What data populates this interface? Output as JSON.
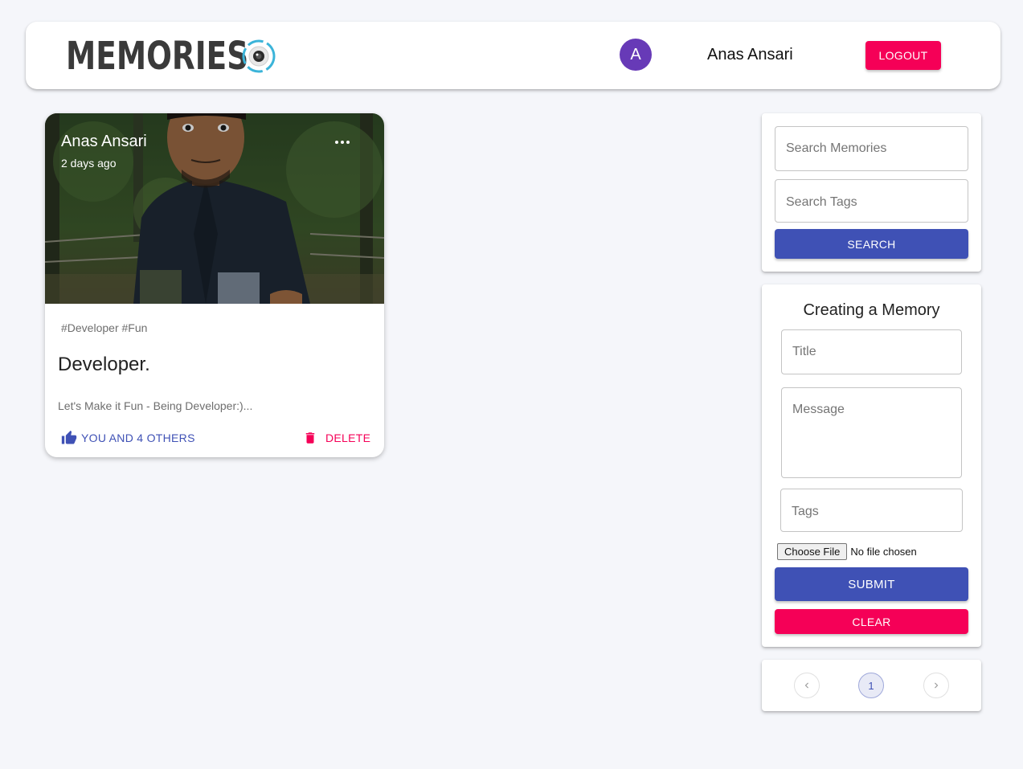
{
  "colors": {
    "primary": "#3f51b5",
    "secondary": "#f50057",
    "avatar": "#673ab7"
  },
  "header": {
    "brand": "MEMORIES",
    "brand_icon": "camera-lens-icon",
    "avatar_initial": "A",
    "user_name": "Anas Ansari",
    "logout_label": "LOGOUT"
  },
  "post": {
    "author": "Anas Ansari",
    "time": "2 days ago",
    "more_icon": "more-horizontal-icon",
    "tags": "#Developer #Fun",
    "title": "Developer.",
    "message": "Let's Make it Fun - Being Developer:)...",
    "like_label": "YOU AND 4 OTHERS",
    "like_icon": "thumb-up-icon",
    "delete_label": "DELETE",
    "delete_icon": "trash-icon"
  },
  "search": {
    "memories_placeholder": "Search Memories",
    "tags_placeholder": "Search Tags",
    "button_label": "SEARCH"
  },
  "form": {
    "heading": "Creating a Memory",
    "title_placeholder": "Title",
    "message_placeholder": "Message",
    "tags_placeholder": "Tags",
    "file_button": "Choose File",
    "file_status": "No file chosen",
    "submit_label": "SUBMIT",
    "clear_label": "CLEAR"
  },
  "pagination": {
    "current_page": "1",
    "prev_icon": "chevron-left-icon",
    "next_icon": "chevron-right-icon"
  }
}
